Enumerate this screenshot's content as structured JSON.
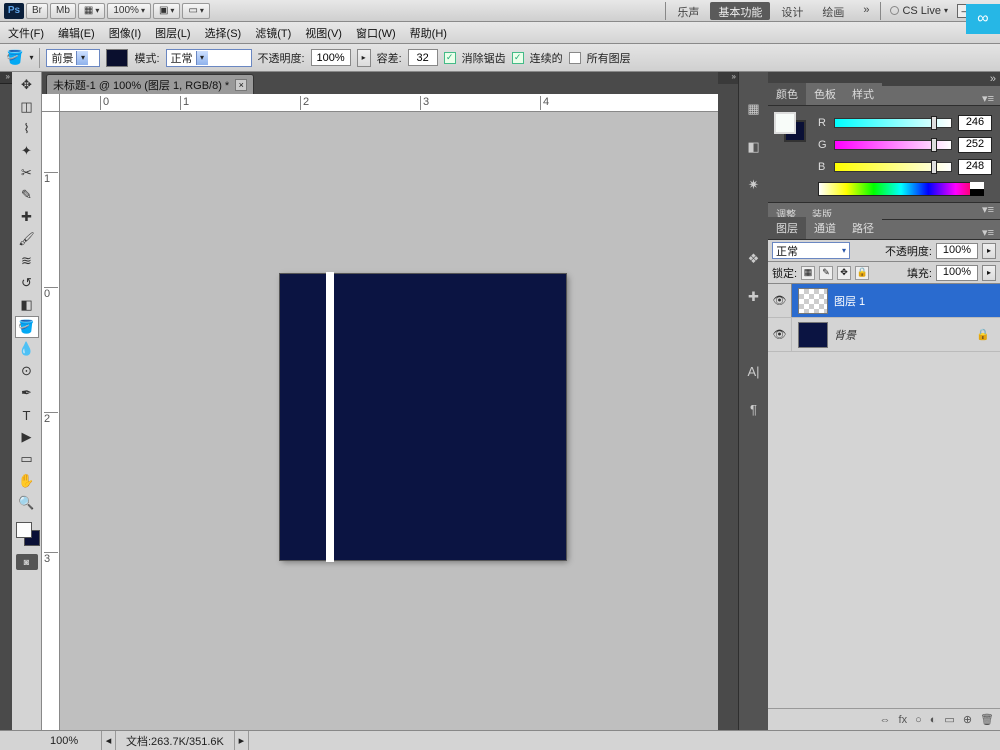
{
  "app_bar": {
    "logo": "Ps",
    "br_btn": "Br",
    "mb_btn": "Mb",
    "zoom": "100%",
    "workspace_tabs": [
      "乐声",
      "基本功能",
      "设计",
      "绘画"
    ],
    "workspace_active": 1,
    "more": "»",
    "cs_live": "CS Live",
    "cloud": "∞"
  },
  "menu": {
    "items": [
      "文件(F)",
      "编辑(E)",
      "图像(I)",
      "图层(L)",
      "选择(S)",
      "滤镜(T)",
      "视图(V)",
      "窗口(W)",
      "帮助(H)"
    ]
  },
  "options": {
    "fill_label": "前景",
    "mode_label": "模式:",
    "mode_value": "正常",
    "opacity_label": "不透明度:",
    "opacity_value": "100%",
    "tolerance_label": "容差:",
    "tolerance_value": "32",
    "antialias": "消除锯齿",
    "contiguous": "连续的",
    "all_layers": "所有图层"
  },
  "doc_tab": "未标题-1 @ 100% (图层 1, RGB/8) *",
  "ruler_marks": [
    "0",
    "1",
    "2",
    "3",
    "4"
  ],
  "ruler_v_marks": [
    "0",
    "1",
    "2",
    "3"
  ],
  "color_panel": {
    "tabs": [
      "颜色",
      "色板",
      "样式"
    ],
    "r": "246",
    "g": "252",
    "b": "248"
  },
  "adjust_tabs": [
    "调整",
    "装版"
  ],
  "layers_panel": {
    "tabs": [
      "图层",
      "通道",
      "路径"
    ],
    "blend": "正常",
    "opacity_label": "不透明度:",
    "opacity": "100%",
    "lock_label": "锁定:",
    "fill_label": "填充:",
    "fill": "100%",
    "layer1": "图层 1",
    "bg": "背景"
  },
  "panel_icons": [
    "▦",
    "◧",
    "✷",
    "❖",
    "✚",
    "A|",
    "¶"
  ],
  "status": {
    "zoom": "100%",
    "doc": "文档:263.7K/351.6K"
  },
  "layers_footer_icons": [
    "⇔",
    "fx",
    "○",
    "◐",
    "▭",
    "⊕",
    "🗑"
  ]
}
